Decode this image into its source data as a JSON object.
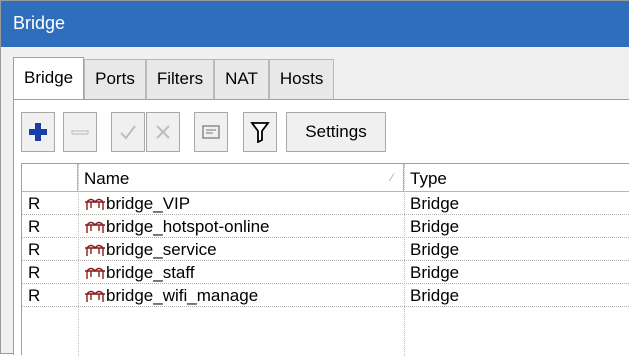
{
  "window": {
    "title": "Bridge"
  },
  "tabs": [
    {
      "label": "Bridge",
      "active": true
    },
    {
      "label": "Ports",
      "active": false
    },
    {
      "label": "Filters",
      "active": false
    },
    {
      "label": "NAT",
      "active": false
    },
    {
      "label": "Hosts",
      "active": false
    }
  ],
  "toolbar": {
    "add_icon": "plus-icon",
    "remove_icon": "minus-icon",
    "enable_icon": "check-icon",
    "disable_icon": "x-icon",
    "comment_icon": "comment-icon",
    "filter_icon": "filter-icon",
    "settings_label": "Settings"
  },
  "table": {
    "columns": [
      "",
      "Name",
      "Type"
    ],
    "rows": [
      {
        "flag": "R",
        "name": "bridge_VIP",
        "type": "Bridge"
      },
      {
        "flag": "R",
        "name": "bridge_hotspot-online",
        "type": "Bridge"
      },
      {
        "flag": "R",
        "name": "bridge_service",
        "type": "Bridge"
      },
      {
        "flag": "R",
        "name": "bridge_staff",
        "type": "Bridge"
      },
      {
        "flag": "R",
        "name": "bridge_wifi_manage",
        "type": "Bridge"
      }
    ]
  },
  "colors": {
    "titlebar": "#2e6ebd",
    "add_icon": "#1a3fa8",
    "bridge_icon": "#8a1a1a"
  }
}
